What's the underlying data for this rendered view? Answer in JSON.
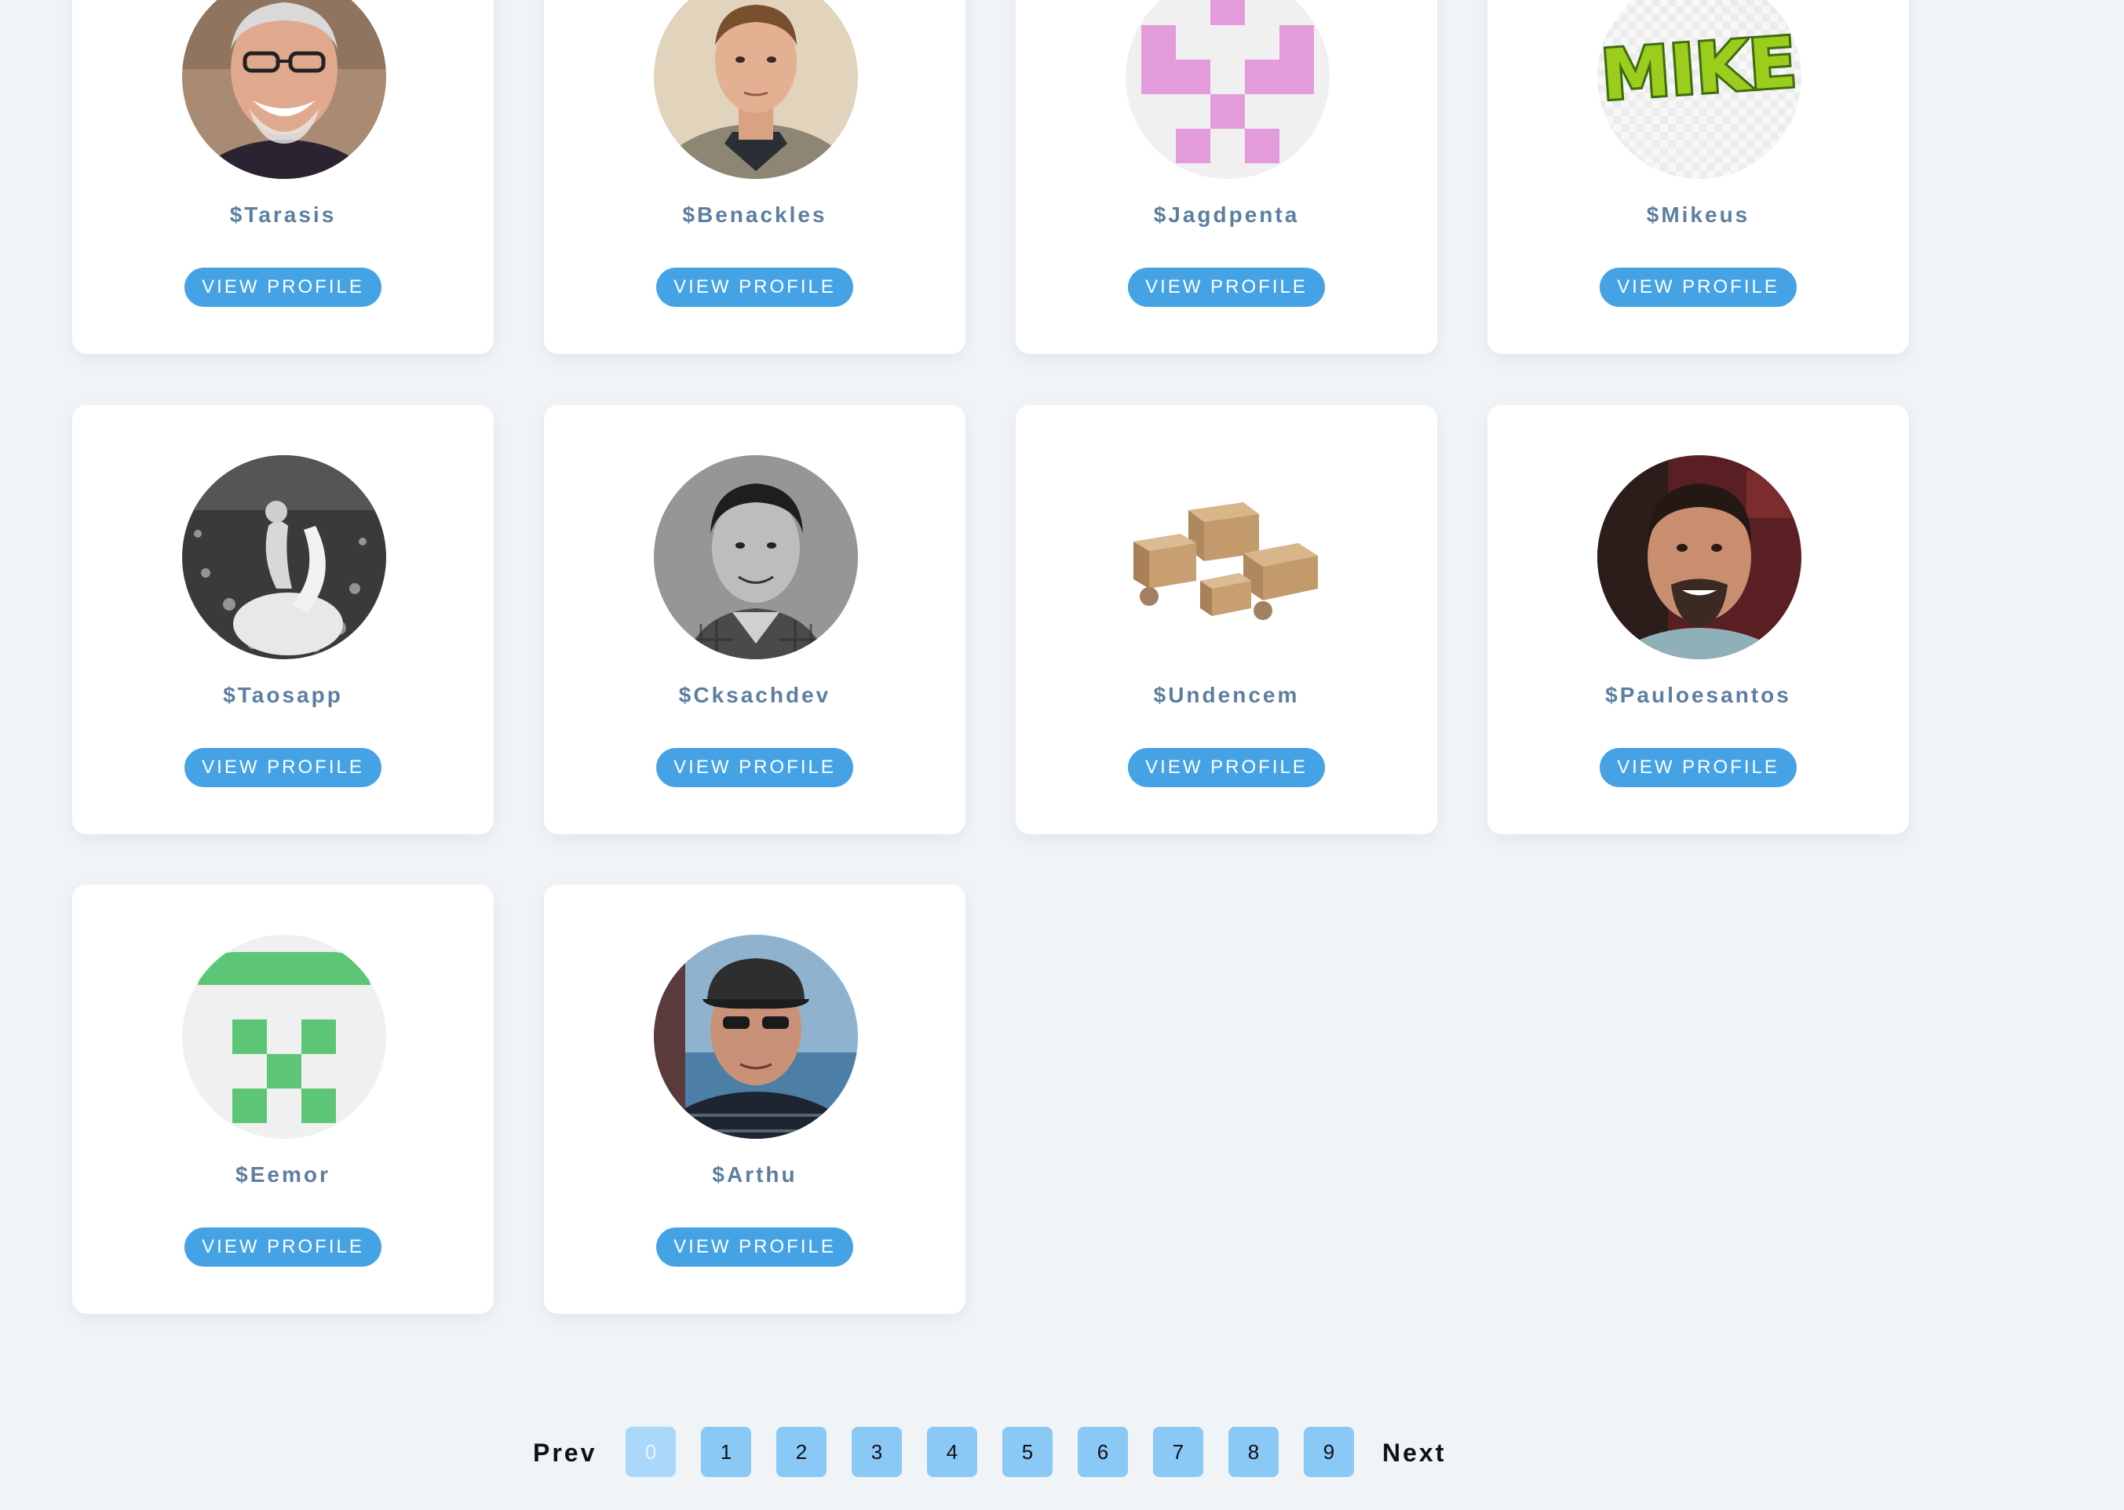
{
  "profiles": [
    {
      "handle": "$Tarasis",
      "button_label": "VIEW PROFILE",
      "avatar": "portrait-older-man-glasses"
    },
    {
      "handle": "$Benackles",
      "button_label": "VIEW PROFILE",
      "avatar": "portrait-young-man"
    },
    {
      "handle": "$Jagdpenta",
      "button_label": "VIEW PROFILE",
      "avatar": "identicon-pink"
    },
    {
      "handle": "$Mikeus",
      "button_label": "VIEW PROFILE",
      "avatar": "mike-logo",
      "avatar_text": "MIKE"
    },
    {
      "handle": "$Taosapp",
      "button_label": "VIEW PROFILE",
      "avatar": "bw-rider-on-horse"
    },
    {
      "handle": "$Cksachdev",
      "button_label": "VIEW PROFILE",
      "avatar": "bw-portrait-man"
    },
    {
      "handle": "$Undencem",
      "button_label": "VIEW PROFILE",
      "avatar": "cardboard-boxes"
    },
    {
      "handle": "$Pauloesantos",
      "button_label": "VIEW PROFILE",
      "avatar": "portrait-man-beard"
    },
    {
      "handle": "$Eemor",
      "button_label": "VIEW PROFILE",
      "avatar": "identicon-green"
    },
    {
      "handle": "$Arthu",
      "button_label": "VIEW PROFILE",
      "avatar": "portrait-man-cap-sunglasses"
    }
  ],
  "pagination": {
    "prev_label": "Prev",
    "next_label": "Next",
    "pages": [
      "0",
      "1",
      "2",
      "3",
      "4",
      "5",
      "6",
      "7",
      "8",
      "9"
    ],
    "current_page": "0"
  },
  "colors": {
    "background": "#f0f4f7",
    "card": "#ffffff",
    "handle_text": "#5d7ea0",
    "button": "#45a3e5",
    "page_button": "#8ac8f6",
    "identicon_pink": "#e39bdc",
    "identicon_green": "#5cc676",
    "mike_green": "#9acd1c"
  }
}
